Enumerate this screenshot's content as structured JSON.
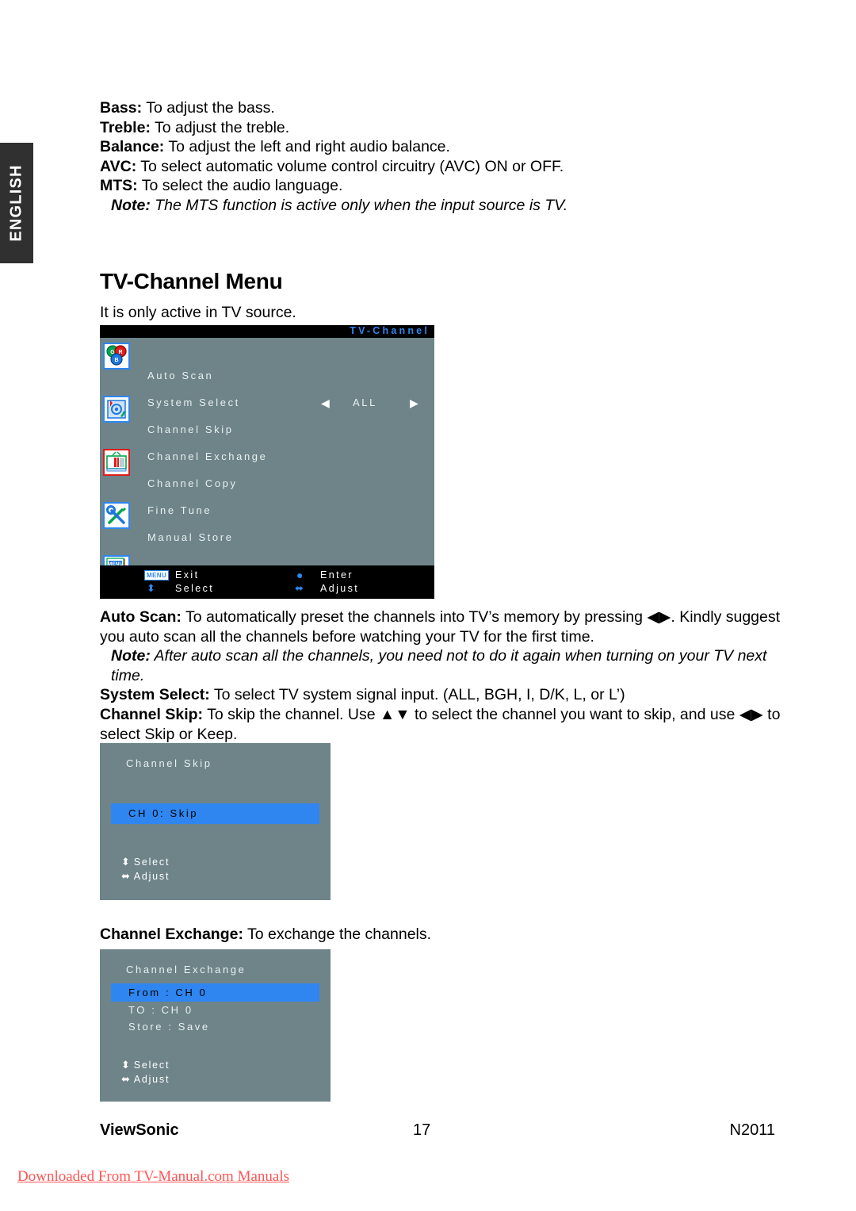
{
  "language_tab": {
    "label": "ENGLISH"
  },
  "audio_settings": [
    {
      "term": "Bass:",
      "desc": " To adjust the bass."
    },
    {
      "term": "Treble:",
      "desc": " To adjust the treble."
    },
    {
      "term": "Balance:",
      "desc": " To adjust the left and right audio balance."
    },
    {
      "term": "AVC:",
      "desc": " To select automatic volume control circuitry (AVC) ON or OFF."
    },
    {
      "term": "MTS:",
      "desc": " To select the audio language."
    }
  ],
  "audio_note": {
    "term": "Note:",
    "desc": " The MTS function is active only when the input source is TV."
  },
  "section": {
    "title": "TV-Channel Menu",
    "intro": "It is only active in TV source."
  },
  "osd_main": {
    "title": "TV-Channel",
    "icons": [
      {
        "name": "rgb-color-icon"
      },
      {
        "name": "audio-icon"
      },
      {
        "name": "tv-picture-icon"
      },
      {
        "name": "tools-icon"
      },
      {
        "name": "menu-document-icon"
      }
    ],
    "rows": [
      {
        "label": "Auto Scan",
        "value": "",
        "arrows": false
      },
      {
        "label": "System Select",
        "value": "ALL",
        "arrows": true
      },
      {
        "label": "Channel Skip",
        "value": "",
        "arrows": false
      },
      {
        "label": "Channel Exchange",
        "value": "",
        "arrows": false
      },
      {
        "label": "Channel Copy",
        "value": "",
        "arrows": false
      },
      {
        "label": "Fine Tune",
        "value": "",
        "arrows": false
      },
      {
        "label": "Manual Store",
        "value": "",
        "arrows": false
      }
    ],
    "footer": {
      "menu_chip": "MENU",
      "exit": "Exit",
      "select": "Select",
      "enter": "Enter",
      "adjust": "Adjust",
      "select_glyph": "⬍",
      "enter_glyph": "●",
      "adjust_glyph": "⬌"
    },
    "arrow_left": "◀",
    "arrow_right": "▶"
  },
  "descriptions": {
    "auto_scan": {
      "term": "Auto Scan:",
      "desc": " To automatically preset the channels into TV’s memory by pressing ◀▶. Kindly suggest you auto scan all the channels before watching your TV for the first time."
    },
    "auto_scan_note": {
      "term": "Note:",
      "desc": " After auto scan all the channels, you need not to do it again when turning on your TV next time."
    },
    "system_select": {
      "term": "System Select:",
      "desc": " To select TV system signal input. (ALL, BGH, I, D/K, L, or L’)"
    },
    "channel_skip": {
      "term": "Channel Skip:",
      "desc": " To skip the channel. Use ▲▼ to select the channel you want to skip, and use ◀▶ to select Skip or Keep."
    },
    "channel_exchange": {
      "term": "Channel Exchange:",
      "desc": " To exchange the channels."
    }
  },
  "osd_channel_skip": {
    "title": "Channel  Skip",
    "highlight_row": "CH   0:    Skip",
    "hints": [
      {
        "glyph": "⬍",
        "label": "Select"
      },
      {
        "glyph": "⬌",
        "label": "Adjust"
      }
    ]
  },
  "osd_channel_exchange": {
    "title": "Channel  Exchange",
    "highlight_row": "From  :  CH    0",
    "rows": [
      "TO     :  CH    0",
      "Store    :  Save"
    ],
    "hints": [
      {
        "glyph": "⬍",
        "label": "Select"
      },
      {
        "glyph": "⬌",
        "label": "Adjust"
      }
    ]
  },
  "page_footer": {
    "brand": "ViewSonic",
    "page_number": "17",
    "model": "N2011"
  },
  "watermark": {
    "text": "Downloaded From TV-Manual.com Manuals"
  },
  "colors": {
    "osd_background": "#6e8489",
    "osd_highlight": "#2f86f0",
    "osd_titlebar": "#000000",
    "osd_text": "#e9f0f0",
    "lang_tab": "#303030",
    "watermark": "#ff5555"
  }
}
